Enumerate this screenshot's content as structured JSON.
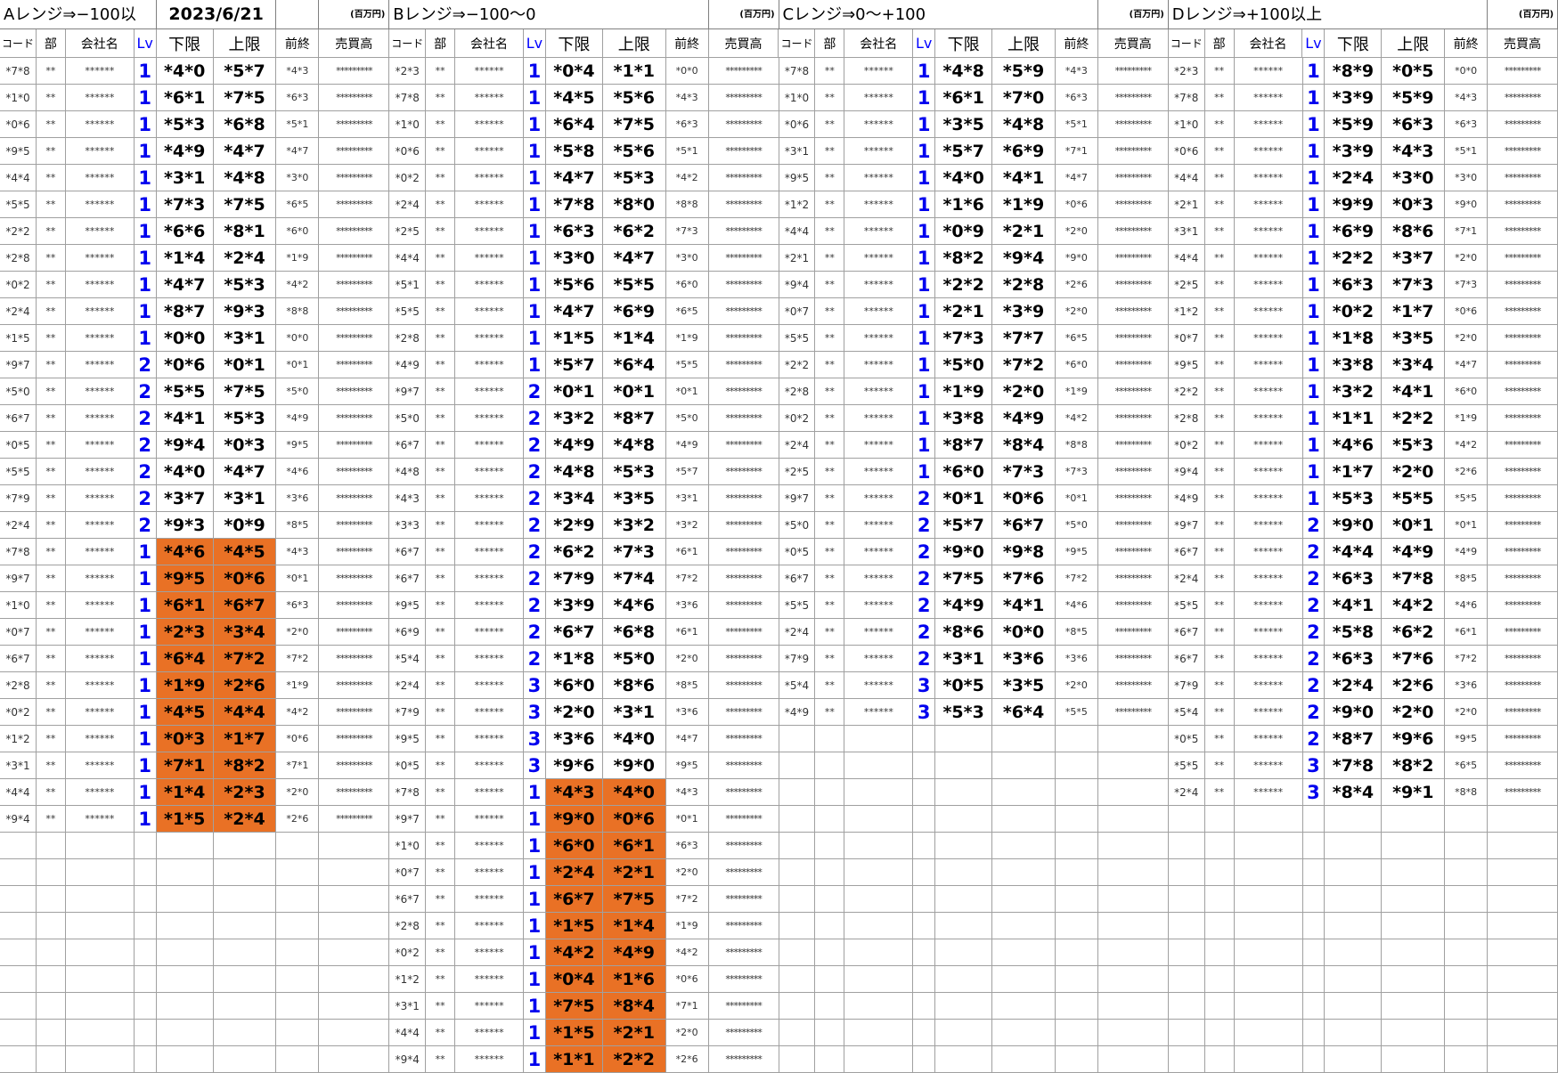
{
  "date": "2023/6/21",
  "unit_label": "(百万円)",
  "columns": {
    "code": "コード",
    "bu": "部",
    "company": "会社名",
    "lv": "Lv",
    "lower": "下限",
    "upper": "上限",
    "prev": "前終",
    "sales": "売買高"
  },
  "mask": {
    "bu": "**",
    "company": "******",
    "sales": "*********"
  },
  "colors": {
    "highlight": "#e97125",
    "lv": "#0000ee"
  },
  "ranges": [
    {
      "title": "Aレンジ⇒−100以",
      "rows": [
        [
          "*7*8",
          "1",
          "*4*0",
          "*5*7",
          "*4*3",
          0
        ],
        [
          "*1*0",
          "1",
          "*6*1",
          "*7*5",
          "*6*3",
          0
        ],
        [
          "*0*6",
          "1",
          "*5*3",
          "*6*8",
          "*5*1",
          0
        ],
        [
          "*9*5",
          "1",
          "*4*9",
          "*4*7",
          "*4*7",
          0
        ],
        [
          "*4*4",
          "1",
          "*3*1",
          "*4*8",
          "*3*0",
          0
        ],
        [
          "*5*5",
          "1",
          "*7*3",
          "*7*5",
          "*6*5",
          0
        ],
        [
          "*2*2",
          "1",
          "*6*6",
          "*8*1",
          "*6*0",
          0
        ],
        [
          "*2*8",
          "1",
          "*1*4",
          "*2*4",
          "*1*9",
          0
        ],
        [
          "*0*2",
          "1",
          "*4*7",
          "*5*3",
          "*4*2",
          0
        ],
        [
          "*2*4",
          "1",
          "*8*7",
          "*9*3",
          "*8*8",
          0
        ],
        [
          "*1*5",
          "1",
          "*0*0",
          "*3*1",
          "*0*0",
          0
        ],
        [
          "*9*7",
          "2",
          "*0*6",
          "*0*1",
          "*0*1",
          0
        ],
        [
          "*5*0",
          "2",
          "*5*5",
          "*7*5",
          "*5*0",
          0
        ],
        [
          "*6*7",
          "2",
          "*4*1",
          "*5*3",
          "*4*9",
          0
        ],
        [
          "*0*5",
          "2",
          "*9*4",
          "*0*3",
          "*9*5",
          0
        ],
        [
          "*5*5",
          "2",
          "*4*0",
          "*4*7",
          "*4*6",
          0
        ],
        [
          "*7*9",
          "2",
          "*3*7",
          "*3*1",
          "*3*6",
          0
        ],
        [
          "*2*4",
          "2",
          "*9*3",
          "*0*9",
          "*8*5",
          0
        ],
        [
          "*7*8",
          "1",
          "*4*6",
          "*4*5",
          "*4*3",
          1
        ],
        [
          "*9*7",
          "1",
          "*9*5",
          "*0*6",
          "*0*1",
          1
        ],
        [
          "*1*0",
          "1",
          "*6*1",
          "*6*7",
          "*6*3",
          1
        ],
        [
          "*0*7",
          "1",
          "*2*3",
          "*3*4",
          "*2*0",
          1
        ],
        [
          "*6*7",
          "1",
          "*6*4",
          "*7*2",
          "*7*2",
          1
        ],
        [
          "*2*8",
          "1",
          "*1*9",
          "*2*6",
          "*1*9",
          1
        ],
        [
          "*0*2",
          "1",
          "*4*5",
          "*4*4",
          "*4*2",
          1
        ],
        [
          "*1*2",
          "1",
          "*0*3",
          "*1*7",
          "*0*6",
          1
        ],
        [
          "*3*1",
          "1",
          "*7*1",
          "*8*2",
          "*7*1",
          1
        ],
        [
          "*4*4",
          "1",
          "*1*4",
          "*2*3",
          "*2*0",
          1
        ],
        [
          "*9*4",
          "1",
          "*1*5",
          "*2*4",
          "*2*6",
          1
        ]
      ]
    },
    {
      "title": "Bレンジ⇒−100〜0",
      "rows": [
        [
          "*2*3",
          "1",
          "*0*4",
          "*1*1",
          "*0*0",
          0
        ],
        [
          "*7*8",
          "1",
          "*4*5",
          "*5*6",
          "*4*3",
          0
        ],
        [
          "*1*0",
          "1",
          "*6*4",
          "*7*5",
          "*6*3",
          0
        ],
        [
          "*0*6",
          "1",
          "*5*8",
          "*5*6",
          "*5*1",
          0
        ],
        [
          "*0*2",
          "1",
          "*4*7",
          "*5*3",
          "*4*2",
          0
        ],
        [
          "*2*4",
          "1",
          "*7*8",
          "*8*0",
          "*8*8",
          0
        ],
        [
          "*2*5",
          "1",
          "*6*3",
          "*6*2",
          "*7*3",
          0
        ],
        [
          "*4*4",
          "1",
          "*3*0",
          "*4*7",
          "*3*0",
          0
        ],
        [
          "*5*1",
          "1",
          "*5*6",
          "*5*5",
          "*6*0",
          0
        ],
        [
          "*5*5",
          "1",
          "*4*7",
          "*6*9",
          "*6*5",
          0
        ],
        [
          "*2*8",
          "1",
          "*1*5",
          "*1*4",
          "*1*9",
          0
        ],
        [
          "*4*9",
          "1",
          "*5*7",
          "*6*4",
          "*5*5",
          0
        ],
        [
          "*9*7",
          "2",
          "*0*1",
          "*0*1",
          "*0*1",
          0
        ],
        [
          "*5*0",
          "2",
          "*3*2",
          "*8*7",
          "*5*0",
          0
        ],
        [
          "*6*7",
          "2",
          "*4*9",
          "*4*8",
          "*4*9",
          0
        ],
        [
          "*4*8",
          "2",
          "*4*8",
          "*5*3",
          "*5*7",
          0
        ],
        [
          "*4*3",
          "2",
          "*3*4",
          "*3*5",
          "*3*1",
          0
        ],
        [
          "*3*3",
          "2",
          "*2*9",
          "*3*2",
          "*3*2",
          0
        ],
        [
          "*6*7",
          "2",
          "*6*2",
          "*7*3",
          "*6*1",
          0
        ],
        [
          "*6*7",
          "2",
          "*7*9",
          "*7*4",
          "*7*2",
          0
        ],
        [
          "*9*5",
          "2",
          "*3*9",
          "*4*6",
          "*3*6",
          0
        ],
        [
          "*6*9",
          "2",
          "*6*7",
          "*6*8",
          "*6*1",
          0
        ],
        [
          "*5*4",
          "2",
          "*1*8",
          "*5*0",
          "*2*0",
          0
        ],
        [
          "*2*4",
          "3",
          "*6*0",
          "*8*6",
          "*8*5",
          0
        ],
        [
          "*7*9",
          "3",
          "*2*0",
          "*3*1",
          "*3*6",
          0
        ],
        [
          "*9*5",
          "3",
          "*3*6",
          "*4*0",
          "*4*7",
          0
        ],
        [
          "*0*5",
          "3",
          "*9*6",
          "*9*0",
          "*9*5",
          0
        ],
        [
          "*7*8",
          "1",
          "*4*3",
          "*4*0",
          "*4*3",
          1
        ],
        [
          "*9*7",
          "1",
          "*9*0",
          "*0*6",
          "*0*1",
          1
        ],
        [
          "*1*0",
          "1",
          "*6*0",
          "*6*1",
          "*6*3",
          1
        ],
        [
          "*0*7",
          "1",
          "*2*4",
          "*2*1",
          "*2*0",
          1
        ],
        [
          "*6*7",
          "1",
          "*6*7",
          "*7*5",
          "*7*2",
          1
        ],
        [
          "*2*8",
          "1",
          "*1*5",
          "*1*4",
          "*1*9",
          1
        ],
        [
          "*0*2",
          "1",
          "*4*2",
          "*4*9",
          "*4*2",
          1
        ],
        [
          "*1*2",
          "1",
          "*0*4",
          "*1*6",
          "*0*6",
          1
        ],
        [
          "*3*1",
          "1",
          "*7*5",
          "*8*4",
          "*7*1",
          1
        ],
        [
          "*4*4",
          "1",
          "*1*5",
          "*2*1",
          "*2*0",
          1
        ],
        [
          "*9*4",
          "1",
          "*1*1",
          "*2*2",
          "*2*6",
          1
        ]
      ]
    },
    {
      "title": "Cレンジ⇒0〜+100",
      "rows": [
        [
          "*7*8",
          "1",
          "*4*8",
          "*5*9",
          "*4*3",
          0
        ],
        [
          "*1*0",
          "1",
          "*6*1",
          "*7*0",
          "*6*3",
          0
        ],
        [
          "*0*6",
          "1",
          "*3*5",
          "*4*8",
          "*5*1",
          0
        ],
        [
          "*3*1",
          "1",
          "*5*7",
          "*6*9",
          "*7*1",
          0
        ],
        [
          "*9*5",
          "1",
          "*4*0",
          "*4*1",
          "*4*7",
          0
        ],
        [
          "*1*2",
          "1",
          "*1*6",
          "*1*9",
          "*0*6",
          0
        ],
        [
          "*4*4",
          "1",
          "*0*9",
          "*2*1",
          "*2*0",
          0
        ],
        [
          "*2*1",
          "1",
          "*8*2",
          "*9*4",
          "*9*0",
          0
        ],
        [
          "*9*4",
          "1",
          "*2*2",
          "*2*8",
          "*2*6",
          0
        ],
        [
          "*0*7",
          "1",
          "*2*1",
          "*3*9",
          "*2*0",
          0
        ],
        [
          "*5*5",
          "1",
          "*7*3",
          "*7*7",
          "*6*5",
          0
        ],
        [
          "*2*2",
          "1",
          "*5*0",
          "*7*2",
          "*6*0",
          0
        ],
        [
          "*2*8",
          "1",
          "*1*9",
          "*2*0",
          "*1*9",
          0
        ],
        [
          "*0*2",
          "1",
          "*3*8",
          "*4*9",
          "*4*2",
          0
        ],
        [
          "*2*4",
          "1",
          "*8*7",
          "*8*4",
          "*8*8",
          0
        ],
        [
          "*2*5",
          "1",
          "*6*0",
          "*7*3",
          "*7*3",
          0
        ],
        [
          "*9*7",
          "2",
          "*0*1",
          "*0*6",
          "*0*1",
          0
        ],
        [
          "*5*0",
          "2",
          "*5*7",
          "*6*7",
          "*5*0",
          0
        ],
        [
          "*0*5",
          "2",
          "*9*0",
          "*9*8",
          "*9*5",
          0
        ],
        [
          "*6*7",
          "2",
          "*7*5",
          "*7*6",
          "*7*2",
          0
        ],
        [
          "*5*5",
          "2",
          "*4*9",
          "*4*1",
          "*4*6",
          0
        ],
        [
          "*2*4",
          "2",
          "*8*6",
          "*0*0",
          "*8*5",
          0
        ],
        [
          "*7*9",
          "2",
          "*3*1",
          "*3*6",
          "*3*6",
          0
        ],
        [
          "*5*4",
          "3",
          "*0*5",
          "*3*5",
          "*2*0",
          0
        ],
        [
          "*4*9",
          "3",
          "*5*3",
          "*6*4",
          "*5*5",
          0
        ]
      ]
    },
    {
      "title": "Dレンジ⇒+100以上",
      "rows": [
        [
          "*2*3",
          "1",
          "*8*9",
          "*0*5",
          "*0*0",
          0
        ],
        [
          "*7*8",
          "1",
          "*3*9",
          "*5*9",
          "*4*3",
          0
        ],
        [
          "*1*0",
          "1",
          "*5*9",
          "*6*3",
          "*6*3",
          0
        ],
        [
          "*0*6",
          "1",
          "*3*9",
          "*4*3",
          "*5*1",
          0
        ],
        [
          "*4*4",
          "1",
          "*2*4",
          "*3*0",
          "*3*0",
          0
        ],
        [
          "*2*1",
          "1",
          "*9*9",
          "*0*3",
          "*9*0",
          0
        ],
        [
          "*3*1",
          "1",
          "*6*9",
          "*8*6",
          "*7*1",
          0
        ],
        [
          "*4*4",
          "1",
          "*2*2",
          "*3*7",
          "*2*0",
          0
        ],
        [
          "*2*5",
          "1",
          "*6*3",
          "*7*3",
          "*7*3",
          0
        ],
        [
          "*1*2",
          "1",
          "*0*2",
          "*1*7",
          "*0*6",
          0
        ],
        [
          "*0*7",
          "1",
          "*1*8",
          "*3*5",
          "*2*0",
          0
        ],
        [
          "*9*5",
          "1",
          "*3*8",
          "*3*4",
          "*4*7",
          0
        ],
        [
          "*2*2",
          "1",
          "*3*2",
          "*4*1",
          "*6*0",
          0
        ],
        [
          "*2*8",
          "1",
          "*1*1",
          "*2*2",
          "*1*9",
          0
        ],
        [
          "*0*2",
          "1",
          "*4*6",
          "*5*3",
          "*4*2",
          0
        ],
        [
          "*9*4",
          "1",
          "*1*7",
          "*2*0",
          "*2*6",
          0
        ],
        [
          "*4*9",
          "1",
          "*5*3",
          "*5*5",
          "*5*5",
          0
        ],
        [
          "*9*7",
          "2",
          "*9*0",
          "*0*1",
          "*0*1",
          0
        ],
        [
          "*6*7",
          "2",
          "*4*4",
          "*4*9",
          "*4*9",
          0
        ],
        [
          "*2*4",
          "2",
          "*6*3",
          "*7*8",
          "*8*5",
          0
        ],
        [
          "*5*5",
          "2",
          "*4*1",
          "*4*2",
          "*4*6",
          0
        ],
        [
          "*6*7",
          "2",
          "*5*8",
          "*6*2",
          "*6*1",
          0
        ],
        [
          "*6*7",
          "2",
          "*6*3",
          "*7*6",
          "*7*2",
          0
        ],
        [
          "*7*9",
          "2",
          "*2*4",
          "*2*6",
          "*3*6",
          0
        ],
        [
          "*5*4",
          "2",
          "*9*0",
          "*2*0",
          "*2*0",
          0
        ],
        [
          "*0*5",
          "2",
          "*8*7",
          "*9*6",
          "*9*5",
          0
        ],
        [
          "*5*5",
          "3",
          "*7*8",
          "*8*2",
          "*6*5",
          0
        ],
        [
          "*2*4",
          "3",
          "*8*4",
          "*9*1",
          "*8*8",
          0
        ]
      ]
    }
  ]
}
